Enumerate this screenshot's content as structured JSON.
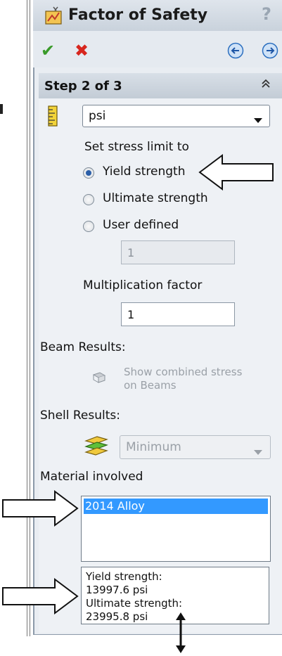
{
  "titlebar": {
    "title": "Factor of Safety",
    "help": "?"
  },
  "toolbar": {
    "ok": "✔",
    "cancel": "✖"
  },
  "step": {
    "header": "Step 2 of 3",
    "collapse": "≈"
  },
  "units": {
    "selected": "psi"
  },
  "stress": {
    "label": "Set stress limit to",
    "options": [
      "Yield strength",
      "Ultimate strength",
      "User defined"
    ],
    "selected_index": 0,
    "user_value": "1"
  },
  "multiplication": {
    "label": "Multiplication factor",
    "value": "1"
  },
  "beam": {
    "label": "Beam Results:",
    "option": "Show combined stress on Beams"
  },
  "shell": {
    "label": "Shell Results:",
    "selected": "Minimum"
  },
  "material": {
    "label": "Material involved",
    "items": [
      "2014 Alloy"
    ]
  },
  "info": {
    "line1": "Yield strength:",
    "line2": "13997.6 psi",
    "line3": "Ultimate strength:",
    "line4": "23995.8 psi"
  },
  "colors": {
    "accent": "#3399ff",
    "ok": "#3a9b2a",
    "cancel": "#d7261e"
  }
}
